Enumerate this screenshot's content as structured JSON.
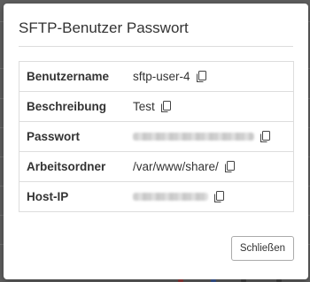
{
  "modal": {
    "title": "SFTP-Benutzer Passwort",
    "rows": [
      {
        "label": "Benutzername",
        "value": "sftp-user-4",
        "redacted": false
      },
      {
        "label": "Beschreibung",
        "value": "Test",
        "redacted": false
      },
      {
        "label": "Passwort",
        "value": "",
        "redacted": true
      },
      {
        "label": "Arbeitsordner",
        "value": "/var/www/share/",
        "redacted": false
      },
      {
        "label": "Host-IP",
        "value": "",
        "redacted": true
      }
    ],
    "close_label": "Schließen"
  },
  "icons": {
    "copy": "copy-icon"
  },
  "colors": {
    "overlay": "#5f5f5f",
    "modal_bg": "#ffffff",
    "border": "#dddddd",
    "text": "#333333"
  }
}
